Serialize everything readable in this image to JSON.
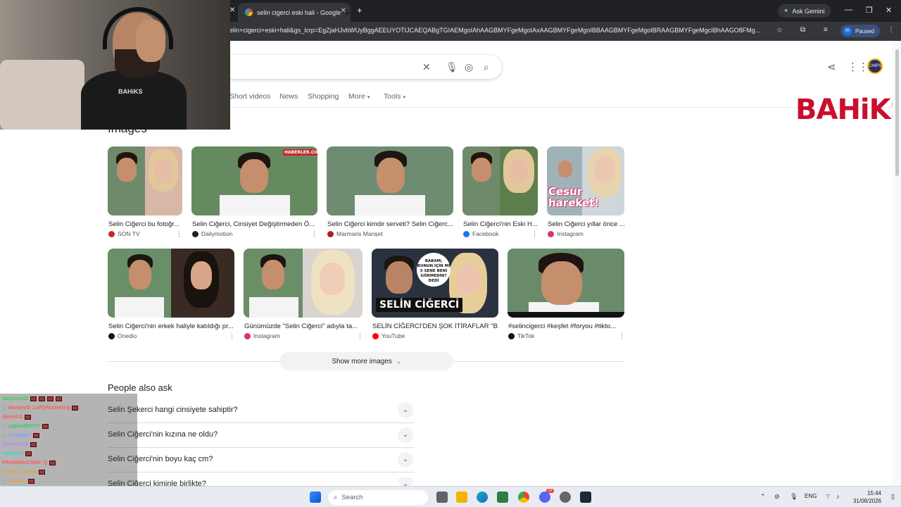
{
  "browser": {
    "tab_title": "selin cigerci eski hali - Google S",
    "tab_close": "✕",
    "new_tab": "+",
    "left_tab_close": "✕",
    "url": "elin+cigerci+eski+hali&gs_lcrp=EgZjaHJvbWUyBggAEEUYOTIJCAEQABgTGIAEMgoIAhAAGBMYFgeMgoIAxAAGBMYFgeMgoIBBAAGBMYFgeMgoIBRAAGBMYFgeMgcIBhAAGO8FMg...",
    "ask_gemini": "Ask Gemini",
    "profile_initial": "m",
    "paused": "Paused"
  },
  "google": {
    "tabs": [
      "Short videos",
      "News",
      "Shopping",
      "More",
      "Tools"
    ],
    "profile_text": "CHIPS",
    "images_title": "Images",
    "show_more": "Show more images",
    "paa_title": "People also ask",
    "paa_questions": [
      "Selin Şekerci hangi cinsiyete sahiptir?",
      "Selin Ciğerci'nin kızına ne oldu?",
      "Selin Ciğerci'nin boyu kaç cm?",
      "Selin Ciğerci kiminle birlikte?"
    ]
  },
  "brand": "BAHiKS",
  "images": [
    {
      "caption": "Selin Ciğerci bu fotoğr...",
      "source": "SON TV",
      "fav": "#c62828"
    },
    {
      "caption": "Selin Ciğerci, Cinsiyet Değiştirmeden Ö...",
      "source": "Dailymotion",
      "fav": "#222222"
    },
    {
      "caption": "Selin Ciğerci kimdir serveti? Selin Ciğerc...",
      "source": "Marmaris Manşet",
      "fav": "#b71c1c"
    },
    {
      "caption": "Selin Ciğerci'nin Eski H...",
      "source": "Facebook",
      "fav": "#1877f2"
    },
    {
      "caption": "Selin Ciğerci yıllar önce ...",
      "source": "Instagram",
      "fav": "#e1306c",
      "overlay": "Cesur hareket!"
    },
    {
      "caption": "Selin Ciğerci'nin erkek haliyle katıldığı pr...",
      "source": "Onedio",
      "fav": "#111111"
    },
    {
      "caption": "Günümüzde \"Selin Ciğerci\" adıyla ta...",
      "source": "Instagram",
      "fav": "#e1306c"
    },
    {
      "caption": "SELİN CİĞERCİ'DEN ŞOK İTİRAFLAR \"B...",
      "source": "YouTube",
      "fav": "#ff0000",
      "overlay": "SELİN CİĞERCİ",
      "overlay2": "BABAM; BUNUN İÇİN Mİ 5 SENE BENİ GÖRMEDİN? DEDİ"
    },
    {
      "caption": "#selincigerci #keşfet #foryou #tikto...",
      "source": "TikTok",
      "fav": "#111111"
    }
  ],
  "chat": [
    {
      "user": "nalyceee22",
      "color": "#39d353",
      "emotes": 4
    },
    {
      "user": "MonkeyD_LuffyPirateKing",
      "color": "#ff5a5a",
      "emotes": 1,
      "badge": true
    },
    {
      "user": "djonyGS",
      "color": "#ff5a5a",
      "emotes": 1
    },
    {
      "user": "yiginn2007??",
      "color": "#2ecc71",
      "emotes": 1,
      "badge": true
    },
    {
      "user": "ZeroMars",
      "color": "#7aa2ff",
      "emotes": 1,
      "badge": true
    },
    {
      "user": "Arwen1919",
      "color": "#c084fc",
      "emotes": 1
    },
    {
      "user": "markoon",
      "color": "#39d3d3",
      "emotes": 1
    },
    {
      "user": "FRANKENSTEIN_Q",
      "color": "#ff5a5a",
      "emotes": 1
    },
    {
      "user": "mitchi_kuhinin",
      "color": "#e8a33d",
      "emotes": 1
    },
    {
      "user": "Smallin",
      "color": "#e8a33d",
      "emotes": 1,
      "badge": true
    },
    {
      "user": "holybanee :",
      "color": "#e8a33d",
      "emotes": 1
    }
  ],
  "taskbar": {
    "search": "Search",
    "lang": "ENG",
    "time": "15:44",
    "date": "31/08/2026",
    "discord_badge": "29"
  },
  "webcam": {
    "shirt_text": "BAHiKS"
  }
}
